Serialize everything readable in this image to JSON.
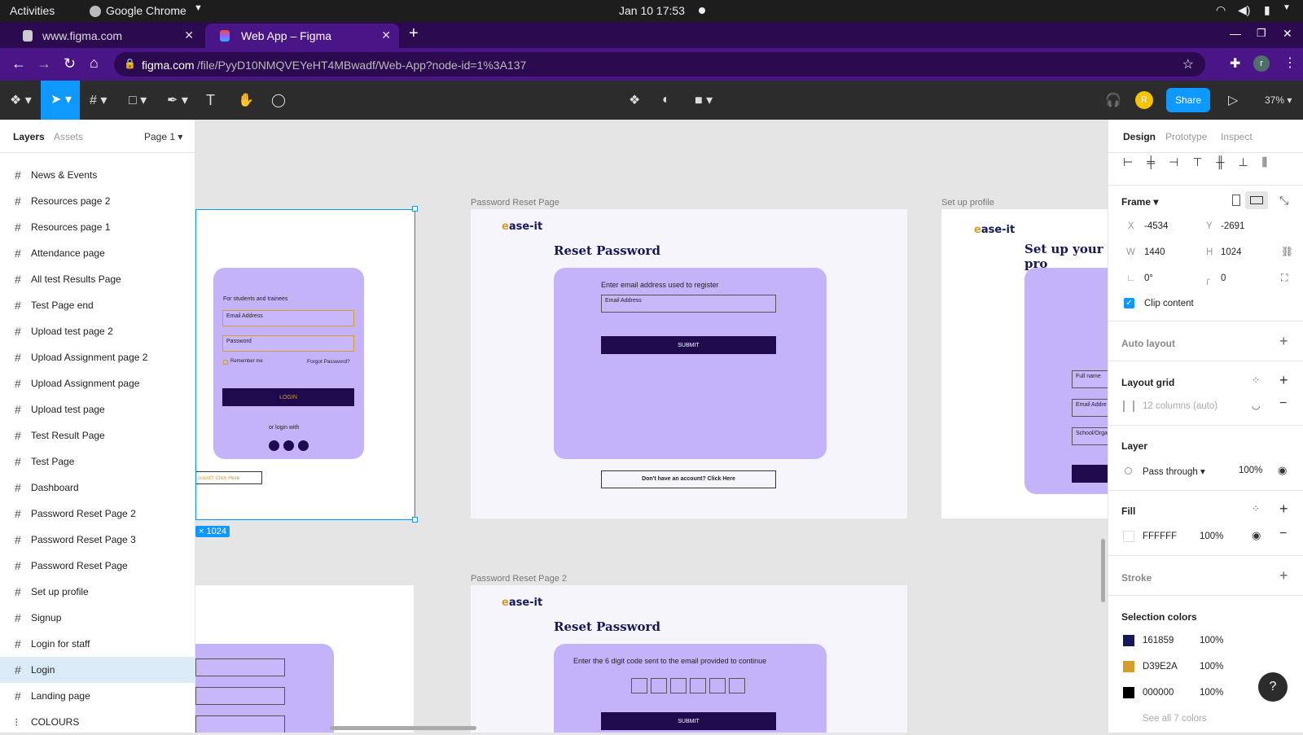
{
  "system": {
    "activities": "Activities",
    "app": "Google Chrome",
    "datetime": "Jan 10  17:53"
  },
  "browser": {
    "tabs": [
      {
        "label": "www.figma.com"
      },
      {
        "label": "Web App – Figma"
      }
    ],
    "url_host": "figma.com",
    "url_path": "/file/PyyD10NMQVEYeHT4MBwadf/Web-App?node-id=1%3A137",
    "avatar": "r"
  },
  "toolbar": {
    "avatar": "R",
    "share": "Share",
    "zoom": "37%"
  },
  "left_panel": {
    "tab_layers": "Layers",
    "tab_assets": "Assets",
    "page": "Page 1",
    "items": [
      {
        "label": "News & Events"
      },
      {
        "label": "Resources page 2"
      },
      {
        "label": "Resources page 1"
      },
      {
        "label": "Attendance page"
      },
      {
        "label": "All test Results Page"
      },
      {
        "label": "Test Page end"
      },
      {
        "label": "Upload test page 2"
      },
      {
        "label": "Upload Assignment page 2"
      },
      {
        "label": "Upload Assignment page"
      },
      {
        "label": "Upload test page"
      },
      {
        "label": "Test Result Page"
      },
      {
        "label": "Test Page"
      },
      {
        "label": "Dashboard"
      },
      {
        "label": "Password Reset Page 2"
      },
      {
        "label": "Password Reset Page 3"
      },
      {
        "label": "Password Reset Page"
      },
      {
        "label": "Set up profile"
      },
      {
        "label": "Signup"
      },
      {
        "label": "Login for staff"
      },
      {
        "label": "Login"
      },
      {
        "label": "Landing page"
      },
      {
        "label": "COLOURS"
      }
    ]
  },
  "canvas": {
    "login": {
      "subtitle": "For students and trainees",
      "email": "Email Address",
      "password": "Password",
      "remember": "Remember me",
      "forgot": "Forgot Password?",
      "login_btn": "LOGIN",
      "or": "or login with",
      "bottom": "count? Click Here",
      "size_badge": "× 1024"
    },
    "reset": {
      "label": "Password Reset Page",
      "logo_a": "e",
      "logo_b": "ase-it",
      "title": "Reset Password",
      "prompt": "Enter email address used to register",
      "email": "Email Address",
      "submit": "SUBMIT",
      "account": "Don't have an account? Click Here"
    },
    "profile": {
      "label": "Set up profile",
      "title": "Set up your pro",
      "full": "Full name",
      "email": "Email Addre",
      "school": "School/Orga"
    },
    "reset2": {
      "label": "Password Reset Page 2",
      "title": "Reset Password",
      "prompt": "Enter the 6 digit code sent to the email provided to continue",
      "submit": "SUBMIT"
    }
  },
  "right_panel": {
    "tabs": {
      "design": "Design",
      "prototype": "Prototype",
      "inspect": "Inspect"
    },
    "frame": "Frame",
    "x": "-4534",
    "y": "-2691",
    "w": "1440",
    "h": "1024",
    "rotation": "0°",
    "radius": "0",
    "clip": "Clip content",
    "auto_layout": "Auto layout",
    "layout_grid": "Layout grid",
    "grid_desc": "12 columns (auto)",
    "layer": "Layer",
    "blend": "Pass through",
    "opacity": "100%",
    "fill": "Fill",
    "fill_hex": "FFFFFF",
    "fill_op": "100%",
    "stroke": "Stroke",
    "sel_colors": "Selection colors",
    "colors": [
      {
        "hex": "161859",
        "op": "100%",
        "color": "#161859"
      },
      {
        "hex": "D39E2A",
        "op": "100%",
        "color": "#D39E2A"
      },
      {
        "hex": "000000",
        "op": "100%",
        "color": "#000000"
      }
    ],
    "see_all": "See all 7 colors"
  }
}
